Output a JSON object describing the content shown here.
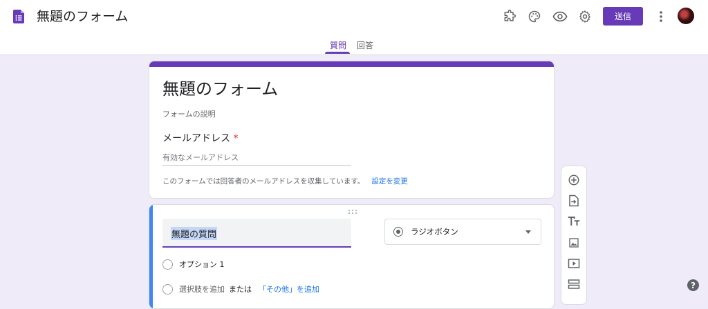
{
  "header": {
    "doc_title": "無題のフォーム",
    "send_label": "送信",
    "icons": [
      "addons-icon",
      "palette-icon",
      "preview-eye-icon",
      "settings-gear-icon",
      "more-vert-icon"
    ]
  },
  "tabs": [
    {
      "label": "質問",
      "active": true
    },
    {
      "label": "回答",
      "active": false
    }
  ],
  "form": {
    "title": "無題のフォーム",
    "description_placeholder": "フォームの説明",
    "email_label": "メールアドレス",
    "required_mark": "*",
    "email_placeholder": "有効なメールアドレス",
    "collect_note": "このフォームでは回答者のメールアドレスを収集しています。",
    "change_settings_link": "設定を変更"
  },
  "question": {
    "title": "無題の質問",
    "type_label": "ラジオボタン",
    "option1": "オプション 1",
    "add_option": "選択肢を追加",
    "or_text": "または",
    "add_other": "「その他」を追加"
  },
  "side_toolbar": [
    "add-question-icon",
    "import-questions-icon",
    "add-title-icon",
    "add-image-icon",
    "add-video-icon",
    "add-section-icon"
  ],
  "colors": {
    "accent": "#673ab7",
    "background": "#f0ebf8",
    "focus_stripe": "#4285f4",
    "link": "#1a73e8"
  }
}
